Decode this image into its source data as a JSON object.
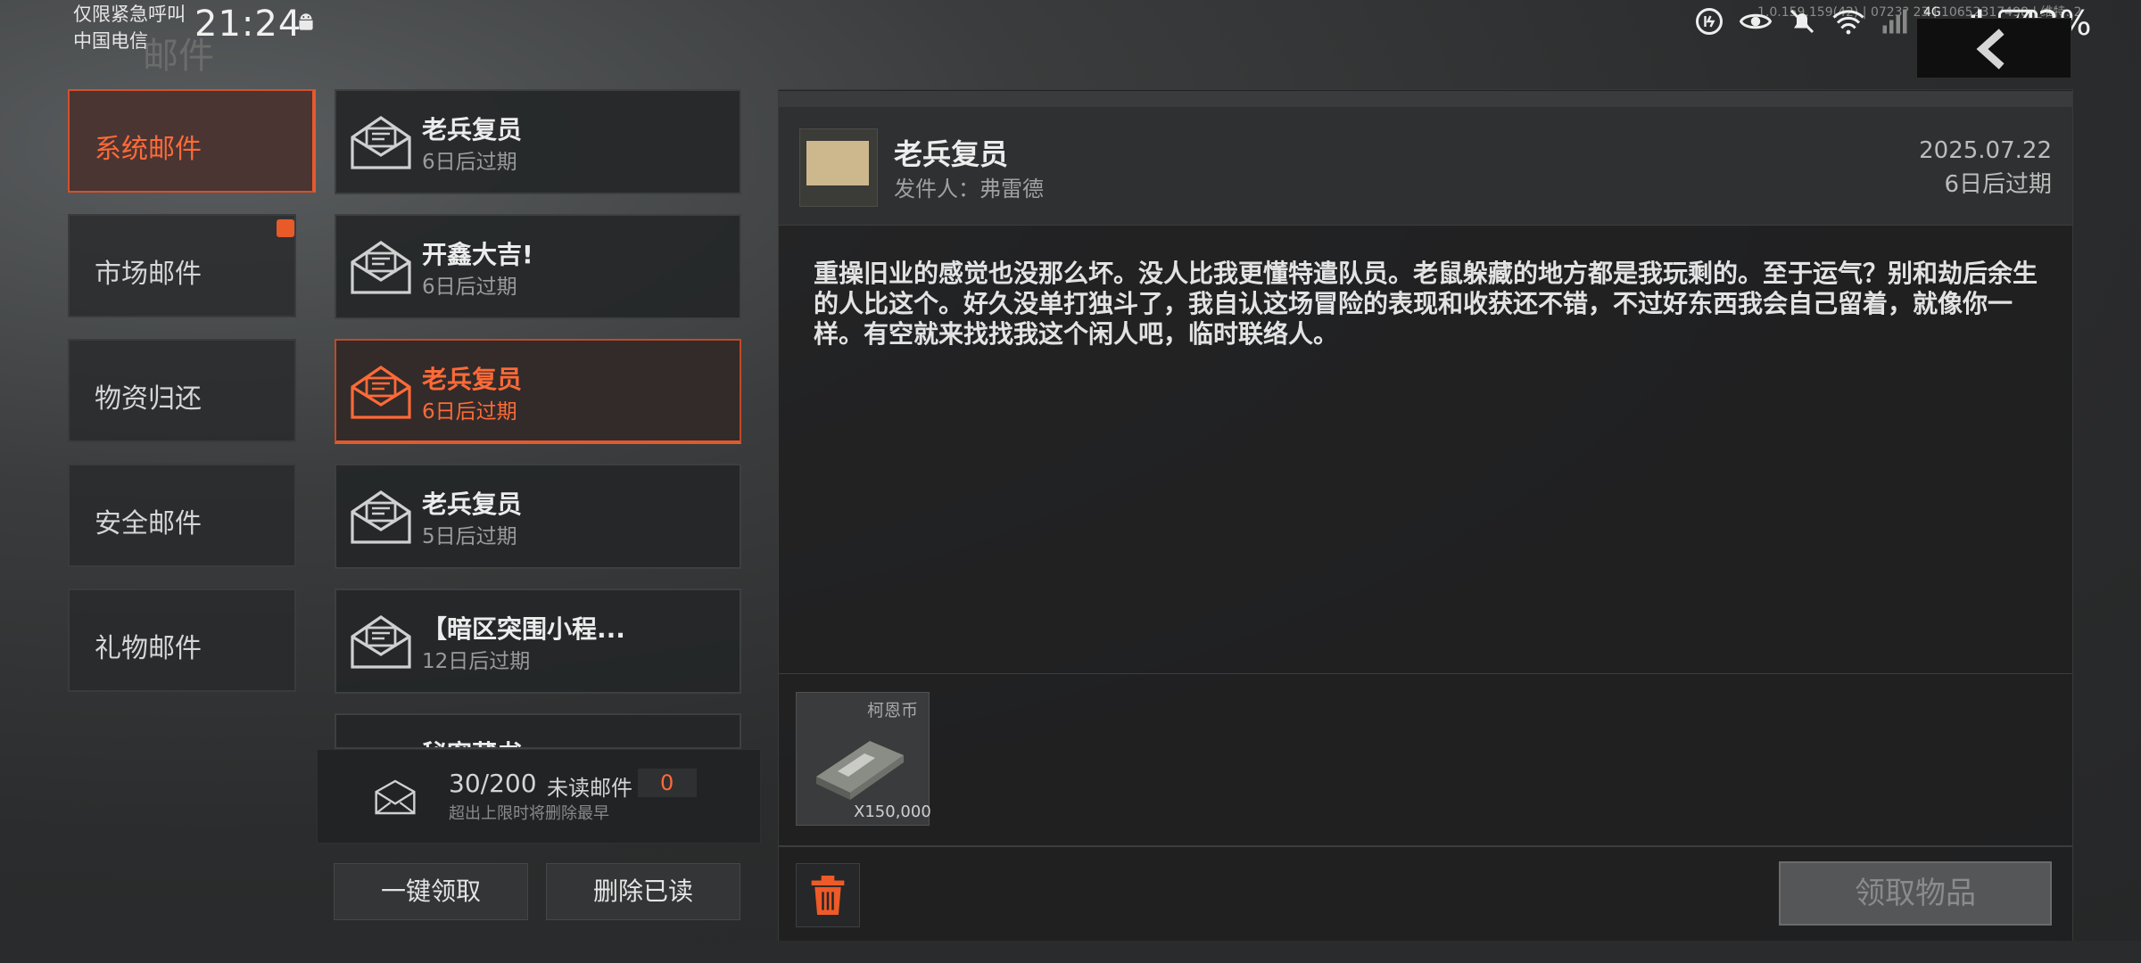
{
  "status_bar": {
    "emergency": "仅限紧急呼叫",
    "carrier": "中国电信",
    "time": "21:24",
    "build": "1.0.159.159(42) | 0723? 23 | 10652317498 | 维特: 2",
    "signal_label": "4G",
    "battery": "42%"
  },
  "page": {
    "title": "邮件"
  },
  "categories": [
    {
      "label": "系统邮件",
      "active": true
    },
    {
      "label": "市场邮件",
      "has_badge": true
    },
    {
      "label": "物资归还"
    },
    {
      "label": "安全邮件"
    },
    {
      "label": "礼物邮件"
    }
  ],
  "mails": [
    {
      "title": "老兵复员",
      "expiry": "6日后过期"
    },
    {
      "title": "开鑫大吉!",
      "expiry": "6日后过期"
    },
    {
      "title": "老兵复员",
      "expiry": "6日后过期",
      "active": true
    },
    {
      "title": "老兵复员",
      "expiry": "5日后过期"
    },
    {
      "title": "【暗区突围小程...",
      "expiry": "12日后过期"
    },
    {
      "title": "秘密藏书",
      "expiry": ""
    }
  ],
  "list_footer": {
    "count": "30/200",
    "unread_label": "未读邮件",
    "unread_count": "0",
    "limit_note": "超出上限时将删除最早",
    "claim_all": "一键领取",
    "delete_read": "删除已读"
  },
  "detail": {
    "title": "老兵复员",
    "sender": "发件人：弗雷德",
    "date": "2025.07.22",
    "expiry": "6日后过期",
    "body": "重操旧业的感觉也没那么坏。没人比我更懂特遣队员。老鼠躲藏的地方都是我玩剩的。至于运气？别和劫后余生的人比这个。好久没单打独斗了，我自认这场冒险的表现和收获还不错，不过好东西我会自己留着，就像你一样。有空就来找找我这个闲人吧，临时联络人。",
    "attachment": {
      "name": "柯恩币",
      "quantity": "X150,000"
    },
    "claim_button": "领取物品"
  },
  "colors": {
    "accent": "#e45a2e",
    "active_text": "#ff6a38"
  }
}
